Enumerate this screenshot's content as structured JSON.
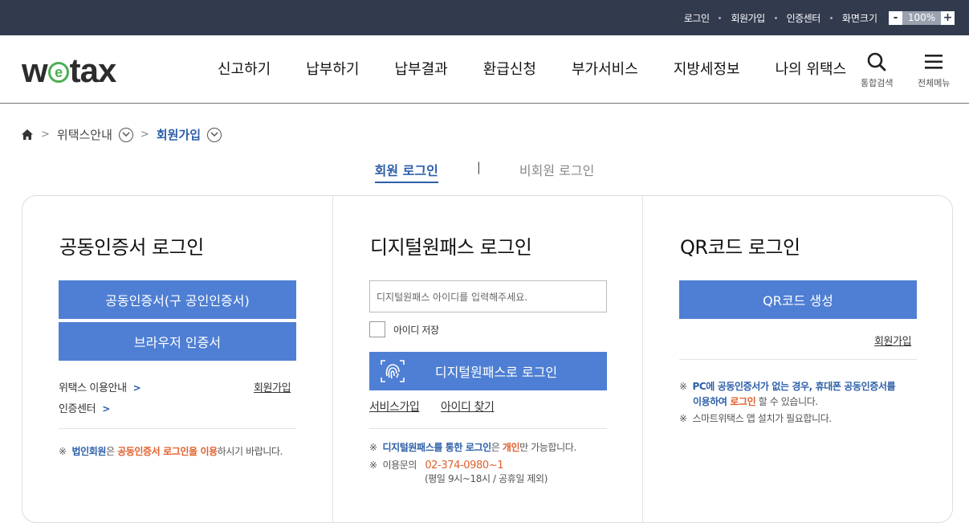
{
  "topbar": {
    "login": "로그인",
    "signup": "회원가입",
    "cert_center": "인증센터",
    "screen_size": "화면크기",
    "zoom_minus": "-",
    "zoom_value": "100%",
    "zoom_plus": "+"
  },
  "header": {
    "logo_w": "w",
    "logo_e": "e",
    "logo_tax": "tax",
    "nav": [
      "신고하기",
      "납부하기",
      "납부결과",
      "환급신청",
      "부가서비스",
      "지방세정보",
      "나의 위택스"
    ],
    "search_label": "통합검색",
    "menu_label": "전체메뉴"
  },
  "breadcrumb": {
    "level1": "위택스안내",
    "level2": "회원가입"
  },
  "tabs": {
    "member": "회원 로그인",
    "nonmember": "비회원 로그인"
  },
  "cert_login": {
    "title": "공동인증서 로그인",
    "btn_cert": "공동인증서(구 공인인증서)",
    "btn_browser": "브라우저 인증서",
    "guide_link": "위택스 이용안내",
    "cert_center_link": "인증센터",
    "signup_link": "회원가입",
    "note_mark": "※",
    "note_part1": "법인회원",
    "note_part2": "은 ",
    "note_part3": "공동인증서 로그인",
    "note_part4": "을 ",
    "note_part5": "이용",
    "note_part6": "하시기 바랍니다."
  },
  "digital_login": {
    "title": "디지털원패스 로그인",
    "id_placeholder": "디지털원패스 아이디를 입력해주세요.",
    "save_id": "아이디 저장",
    "btn_login": "디지털원패스로 로그인",
    "service_join": "서비스가입",
    "find_id": "아이디 찾기",
    "note1_mark": "※",
    "note1_part1": "디지털원패스를 통한 로그인",
    "note1_part2": "은 ",
    "note1_part3": "개인",
    "note1_part4": "만 가능합니다.",
    "note2_mark": "※",
    "note2_label": "이용문의",
    "note2_phone": "02-374-0980~1",
    "note2_hours": "(평일 9시~18시 / 공휴일 제외)"
  },
  "qr_login": {
    "title": "QR코드 로그인",
    "btn_qr": "QR코드 생성",
    "signup_link": "회원가입",
    "note1_mark": "※",
    "note1_part1": "PC에 공동인증서가 없는 경우, 휴대폰 공동인증서를",
    "note1_part2": "이용하여 ",
    "note1_part3": "로그인",
    "note1_part4": " 할 수 있습니다.",
    "note2_mark": "※",
    "note2_text": "스마트위택스 앱 설치가 필요합니다."
  },
  "colors": {
    "topbar_bg": "#323a4e",
    "primary_button": "#4f7fd4",
    "accent_blue": "#2c5fa8",
    "accent_orange": "#e0602c",
    "logo_green": "#4caf50"
  }
}
